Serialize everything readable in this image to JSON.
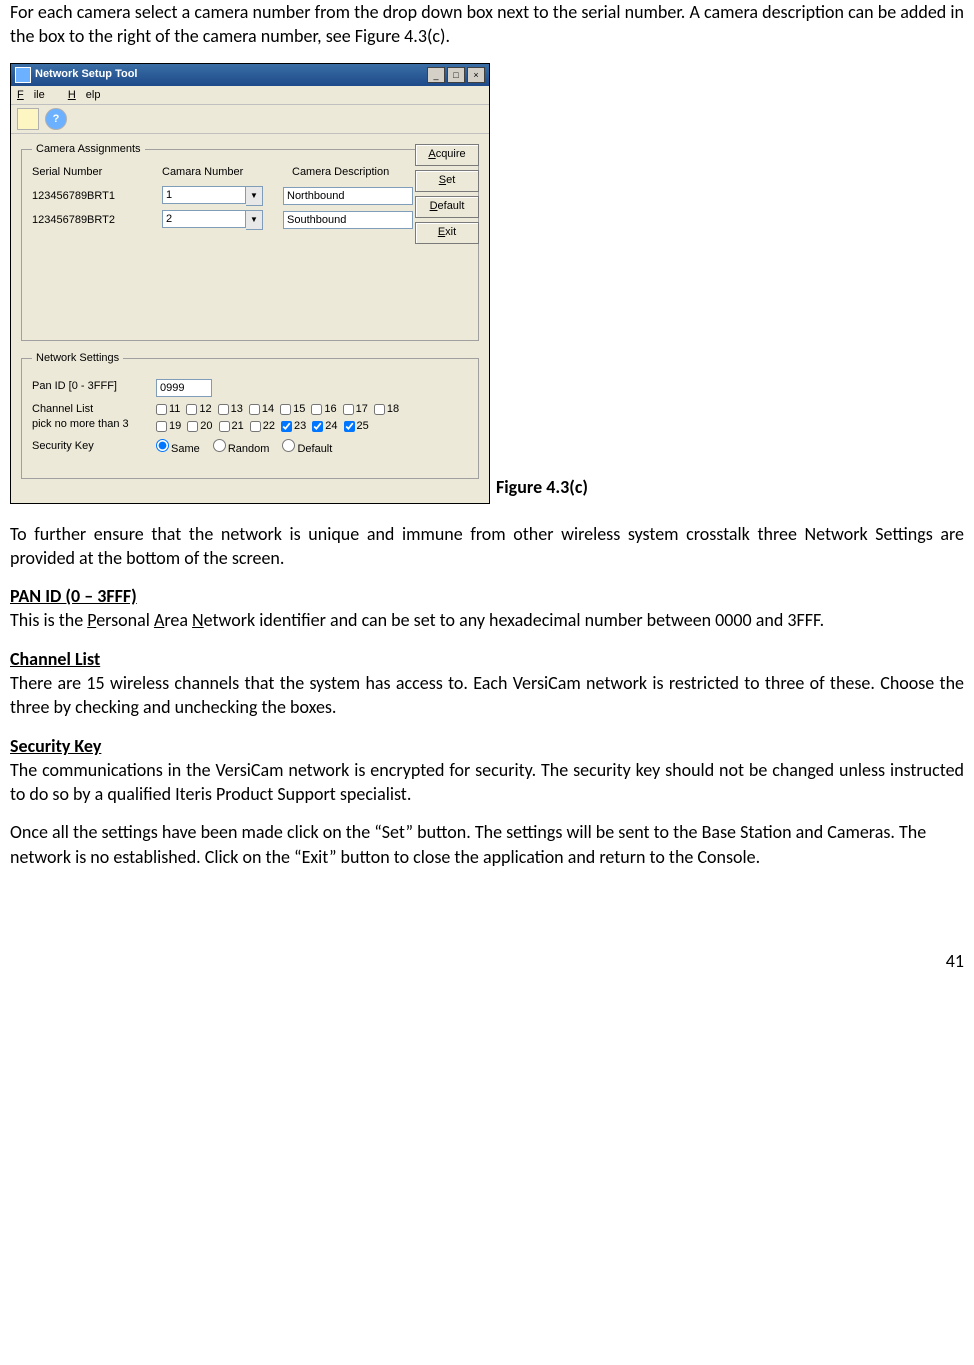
{
  "intro": "For each camera select a camera number from the drop down box next to the serial number. A camera description can be added in the box to the right of the camera number, see Figure 4.3(c).",
  "figure_label": "Figure 4.3(c)",
  "window": {
    "title": "Network Setup Tool",
    "menu": {
      "file": "File",
      "file_key": "F",
      "help": "Help",
      "help_key": "H"
    },
    "buttons": {
      "acquire": "Acquire",
      "set": "Set",
      "default": "Default",
      "exit": "Exit"
    },
    "camera_group": {
      "legend": "Camera Assignments",
      "headers": {
        "serial": "Serial Number",
        "number": "Camara Number",
        "desc": "Camera Description"
      },
      "rows": [
        {
          "serial": "123456789BRT1",
          "number": "1",
          "desc": "Northbound"
        },
        {
          "serial": "123456789BRT2",
          "number": "2",
          "desc": "Southbound"
        }
      ]
    },
    "network_group": {
      "legend": "Network Settings",
      "pan_label": "Pan ID [0 - 3FFF]",
      "pan_value": "0999",
      "chan_label1": "Channel List",
      "chan_label2": "pick no more than 3",
      "channels": [
        {
          "n": "11",
          "c": false
        },
        {
          "n": "12",
          "c": false
        },
        {
          "n": "13",
          "c": false
        },
        {
          "n": "14",
          "c": false
        },
        {
          "n": "15",
          "c": false
        },
        {
          "n": "16",
          "c": false
        },
        {
          "n": "17",
          "c": false
        },
        {
          "n": "18",
          "c": false
        },
        {
          "n": "19",
          "c": false
        },
        {
          "n": "20",
          "c": false
        },
        {
          "n": "21",
          "c": false
        },
        {
          "n": "22",
          "c": false
        },
        {
          "n": "23",
          "c": true
        },
        {
          "n": "24",
          "c": true
        },
        {
          "n": "25",
          "c": true
        }
      ],
      "sec_label": "Security Key",
      "sec_options": {
        "same": "Same",
        "random": "Random",
        "default": "Default"
      },
      "sec_selected": "same"
    }
  },
  "para_after_fig": "To further ensure that the network is unique and immune from other wireless system crosstalk three Network Settings are provided at the bottom of the screen.",
  "sections": {
    "pan": {
      "head": "PAN ID (0 – 3FFF)",
      "body_pre": " This is the ",
      "p_word": "Personal ",
      "a_word": "Area ",
      "n_word": "Network identifier and can be set to any hexadecimal number between 0000 and 3FFF."
    },
    "chan": {
      "head": "Channel List",
      "body": "There are 15 wireless channels that the system has access to. Each VersiCam network is restricted to three of these. Choose the three by checking and unchecking the boxes."
    },
    "sec": {
      "head": "Security Key",
      "body": "The communications in the VersiCam network is encrypted for security. The security key should not be changed unless instructed to do so by a qualified Iteris Product Support specialist."
    }
  },
  "closing": "Once all the settings have been made click on the “Set” button. The settings will be sent to the Base Station and Cameras. The network is no established. Click on the “Exit” button to close the application and return to the Console.",
  "page_number": "41"
}
